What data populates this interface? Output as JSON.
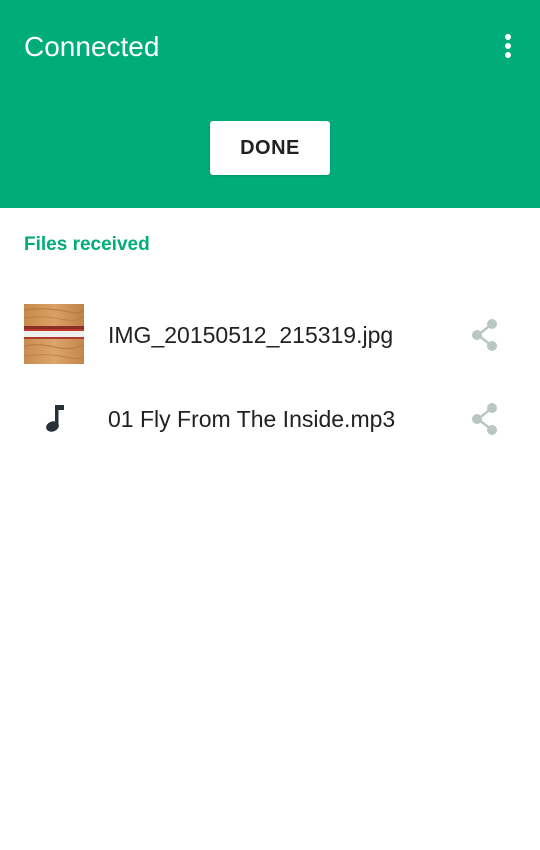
{
  "header": {
    "title": "Connected",
    "done_label": "DONE",
    "background_color": "#00ac79",
    "menu_icon": "more-vert-icon"
  },
  "section": {
    "label": "Files received",
    "label_color": "#00ac79"
  },
  "files": [
    {
      "name": "IMG_20150512_215319.jpg",
      "icon": "image-thumbnail",
      "action_icon": "share-icon"
    },
    {
      "name": "01 Fly From The Inside.mp3",
      "icon": "music-note-icon",
      "action_icon": "share-icon"
    }
  ]
}
